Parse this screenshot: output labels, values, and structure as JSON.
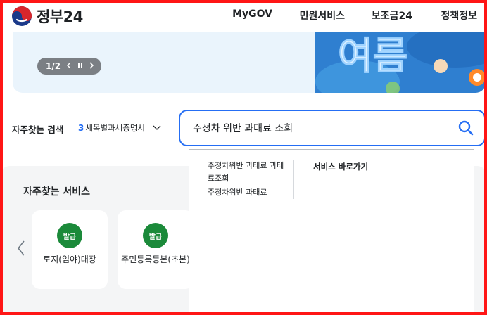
{
  "header": {
    "logo_text": "정부24",
    "nav": [
      "MyGOV",
      "민원서비스",
      "보조금24",
      "정책정보"
    ]
  },
  "banner": {
    "pager": {
      "current": 1,
      "total": 2,
      "label": "1/2",
      "prev_icon": "chevron-left-icon",
      "pause_icon": "pause-icon",
      "next_icon": "chevron-right-icon"
    }
  },
  "faq_search": {
    "label": "자주찾는 검색",
    "selected_num": "3",
    "selected_text": "세목별과세증명서",
    "chevron_icon": "chevron-down-icon"
  },
  "search": {
    "value": "주정차 위반 과태료 조회",
    "button_icon": "search-icon",
    "accent": "#256ef4"
  },
  "autocomplete": {
    "suggestions": [
      "주정차위반 과태료 과태료조회",
      "주정차위반 과태료"
    ],
    "shortcut_title": "서비스 바로가기"
  },
  "services": {
    "title": "자주찾는 서비스",
    "prev_icon": "chevron-left-icon",
    "cards": [
      {
        "badge": "발급",
        "title": "토지(임야)대장"
      },
      {
        "badge": "발급",
        "title": "주민등록등본(초본)"
      }
    ],
    "badge_color": "#1b8a3a"
  }
}
